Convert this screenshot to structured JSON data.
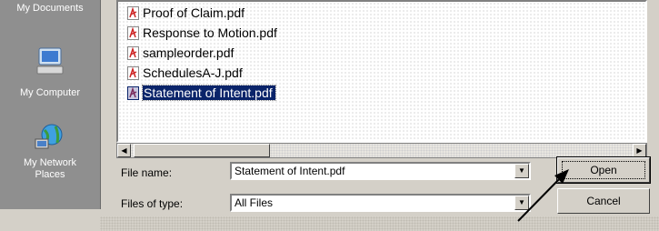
{
  "places": {
    "my_documents": "My Documents",
    "my_computer": "My Computer",
    "my_network_places_line1": "My Network",
    "my_network_places_line2": "Places"
  },
  "files": [
    {
      "name": "Proof of Claim.pdf",
      "selected": false
    },
    {
      "name": "Response to Motion.pdf",
      "selected": false
    },
    {
      "name": "sampleorder.pdf",
      "selected": false
    },
    {
      "name": "SchedulesA-J.pdf",
      "selected": false
    },
    {
      "name": "Statement of Intent.pdf",
      "selected": true
    }
  ],
  "form": {
    "file_name_label": "File name:",
    "file_name_value": "Statement of Intent.pdf",
    "files_of_type_label": "Files of type:",
    "files_of_type_value": "All Files"
  },
  "buttons": {
    "open": "Open",
    "cancel": "Cancel"
  },
  "colors": {
    "selection": "#0a246a",
    "pdf_icon": "#cc2222",
    "places_bar": "#8f8f8f"
  }
}
